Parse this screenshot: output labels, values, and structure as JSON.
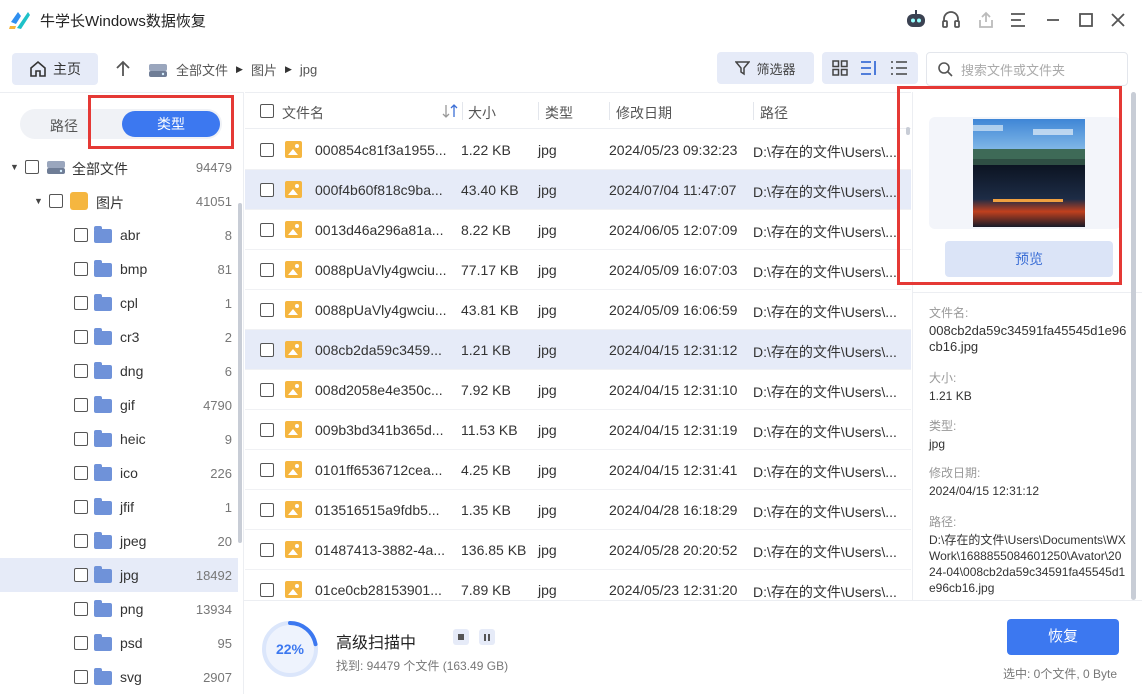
{
  "app": {
    "title": "牛学长Windows数据恢复"
  },
  "toolbar": {
    "home_label": "主页",
    "breadcrumb": [
      "全部文件",
      "图片",
      "jpg"
    ],
    "filter_label": "筛选器",
    "search_placeholder": "搜索文件或文件夹"
  },
  "sidebar": {
    "tab_path": "路径",
    "tab_type": "类型",
    "tree": [
      {
        "label": "全部文件",
        "count": "94479"
      },
      {
        "label": "图片",
        "count": "41051"
      },
      {
        "label": "abr",
        "count": "8"
      },
      {
        "label": "bmp",
        "count": "81"
      },
      {
        "label": "cpl",
        "count": "1"
      },
      {
        "label": "cr3",
        "count": "2"
      },
      {
        "label": "dng",
        "count": "6"
      },
      {
        "label": "gif",
        "count": "4790"
      },
      {
        "label": "heic",
        "count": "9"
      },
      {
        "label": "ico",
        "count": "226"
      },
      {
        "label": "jfif",
        "count": "1"
      },
      {
        "label": "jpeg",
        "count": "20"
      },
      {
        "label": "jpg",
        "count": "18492"
      },
      {
        "label": "png",
        "count": "13934"
      },
      {
        "label": "psd",
        "count": "95"
      },
      {
        "label": "svg",
        "count": "2907"
      }
    ]
  },
  "list": {
    "headers": {
      "name": "文件名",
      "size": "大小",
      "type": "类型",
      "date": "修改日期",
      "path": "路径"
    },
    "rows": [
      {
        "name": "000854c81f3a1955...",
        "size": "1.22 KB",
        "type": "jpg",
        "date": "2024/05/23 09:32:23",
        "path": "D:\\存在的文件\\Users\\..."
      },
      {
        "name": "000f4b60f818c9ba...",
        "size": "43.40 KB",
        "type": "jpg",
        "date": "2024/07/04 11:47:07",
        "path": "D:\\存在的文件\\Users\\..."
      },
      {
        "name": "0013d46a296a81a...",
        "size": "8.22 KB",
        "type": "jpg",
        "date": "2024/06/05 12:07:09",
        "path": "D:\\存在的文件\\Users\\..."
      },
      {
        "name": "0088pUaVly4gwciu...",
        "size": "77.17 KB",
        "type": "jpg",
        "date": "2024/05/09 16:07:03",
        "path": "D:\\存在的文件\\Users\\..."
      },
      {
        "name": "0088pUaVly4gwciu...",
        "size": "43.81 KB",
        "type": "jpg",
        "date": "2024/05/09 16:06:59",
        "path": "D:\\存在的文件\\Users\\..."
      },
      {
        "name": "008cb2da59c3459...",
        "size": "1.21 KB",
        "type": "jpg",
        "date": "2024/04/15 12:31:12",
        "path": "D:\\存在的文件\\Users\\..."
      },
      {
        "name": "008d2058e4e350c...",
        "size": "7.92 KB",
        "type": "jpg",
        "date": "2024/04/15 12:31:10",
        "path": "D:\\存在的文件\\Users\\..."
      },
      {
        "name": "009b3bd341b365d...",
        "size": "11.53 KB",
        "type": "jpg",
        "date": "2024/04/15 12:31:19",
        "path": "D:\\存在的文件\\Users\\..."
      },
      {
        "name": "0101ff6536712cea...",
        "size": "4.25 KB",
        "type": "jpg",
        "date": "2024/04/15 12:31:41",
        "path": "D:\\存在的文件\\Users\\..."
      },
      {
        "name": "013516515a9fdb5...",
        "size": "1.35 KB",
        "type": "jpg",
        "date": "2024/04/28 16:18:29",
        "path": "D:\\存在的文件\\Users\\..."
      },
      {
        "name": "01487413-3882-4a...",
        "size": "136.85 KB",
        "type": "jpg",
        "date": "2024/05/28 20:20:52",
        "path": "D:\\存在的文件\\Users\\..."
      },
      {
        "name": "01ce0cb28153901...",
        "size": "7.89 KB",
        "type": "jpg",
        "date": "2024/05/23 12:31:20",
        "path": "D:\\存在的文件\\Users\\..."
      }
    ]
  },
  "preview": {
    "button_label": "预览",
    "name_label": "文件名:",
    "name_value": "008cb2da59c34591fa45545d1e96cb16.jpg",
    "size_label": "大小:",
    "size_value": "1.21 KB",
    "type_label": "类型:",
    "type_value": "jpg",
    "date_label": "修改日期:",
    "date_value": "2024/04/15 12:31:12",
    "path_label": "路径:",
    "path_value": "D:\\存在的文件\\Users\\Documents\\WXWork\\1688855084601250\\Avator\\2024-04\\008cb2da59c34591fa45545d1e96cb16.jpg"
  },
  "status": {
    "percent": "22%",
    "progress_fraction": 0.22,
    "title": "高级扫描中",
    "found": "找到: 94479 个文件 (163.49 GB)",
    "recover_label": "恢复",
    "selected": "选中: 0个文件, 0 Byte"
  },
  "colors": {
    "accent": "#3c78f0",
    "selected_row": "#e6ebf8",
    "highlight_box": "#e53935"
  }
}
